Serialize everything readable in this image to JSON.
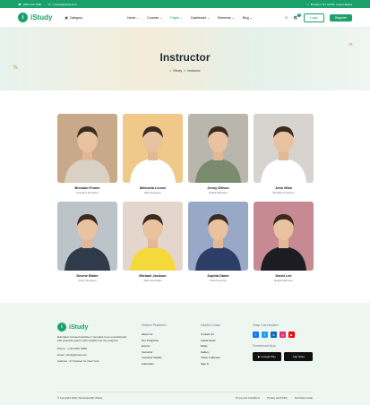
{
  "topbar": {
    "phone": "(000) 444 7890",
    "email": "contact@istudy.com",
    "address": "Brooklyn, NY 10036, United States"
  },
  "header": {
    "brand": "iStudy",
    "category": "Category",
    "nav": [
      "Home",
      "Courses",
      "Pages",
      "Dashboard",
      "Elements",
      "Blog"
    ],
    "active_nav": "Pages",
    "cart_count": "0",
    "login": "Login",
    "register": "Register"
  },
  "hero": {
    "title": "Instructor",
    "breadcrumb_home": "iStudy",
    "breadcrumb_sep": ">",
    "breadcrumb_current": "Instructor"
  },
  "instructors": [
    {
      "name": "Brendan Fraser",
      "role": "Graphics Designer",
      "bg": "#c8a98a",
      "shirt": "#d9d1c3"
    },
    {
      "name": "Michaela Leonel",
      "role": "Web Designer",
      "bg": "#f0c98a",
      "shirt": "#ffffff"
    },
    {
      "name": "Jenny Wilson",
      "role": "Digital Marketer",
      "bg": "#b8b6ad",
      "shirt": "#7b8b6e"
    },
    {
      "name": "John Wick",
      "role": "WordPress Expert",
      "bg": "#d7d3cf",
      "shirt": "#ffffff"
    },
    {
      "name": "Devine Blaire",
      "role": "UI/UX Designer",
      "bg": "#bcc3c9",
      "shirt": "#2f3a4a"
    },
    {
      "name": "Michael Jackson",
      "role": "SEO Specialist",
      "bg": "#e4d6cc",
      "shirt": "#f4d93a"
    },
    {
      "name": "Sophia Dante",
      "role": "Data Scientist",
      "bg": "#9aa8c7",
      "shirt": "#2d3e66"
    },
    {
      "name": "David Lee",
      "role": "Digital Marketer",
      "bg": "#c78a93",
      "shirt": "#1c1c22"
    }
  ],
  "footer": {
    "brand": "iStudy",
    "description": "Education focused website or template is an essential part that powerful system with insights into the program.",
    "phone": "Phone : +724 4567 8900",
    "email": "Email : istudy@mail.com",
    "address": "Address : 27 Division St, New York",
    "col1_title": "Online Platform",
    "col1_links": [
      "About Us",
      "Our Programs",
      "Events",
      "Instructor",
      "Instructor Details",
      "Admission"
    ],
    "col2_title": "Useful Links",
    "col2_links": [
      "Contact Us",
      "Latest News",
      "FAQs",
      "Gallery",
      "Vision & Mission",
      "Sign In"
    ],
    "col3_title": "Stay Connected",
    "download_title": "Download App",
    "google_play": "Google Play",
    "app_store": "App Store",
    "copyright": "© Copyright 2023 | Developed By iStudy",
    "bottom_links": [
      "Terms and Conditions",
      "Privacy and Policy",
      "Purchase Guide"
    ]
  },
  "colors": {
    "accent": "#1aa16a"
  }
}
